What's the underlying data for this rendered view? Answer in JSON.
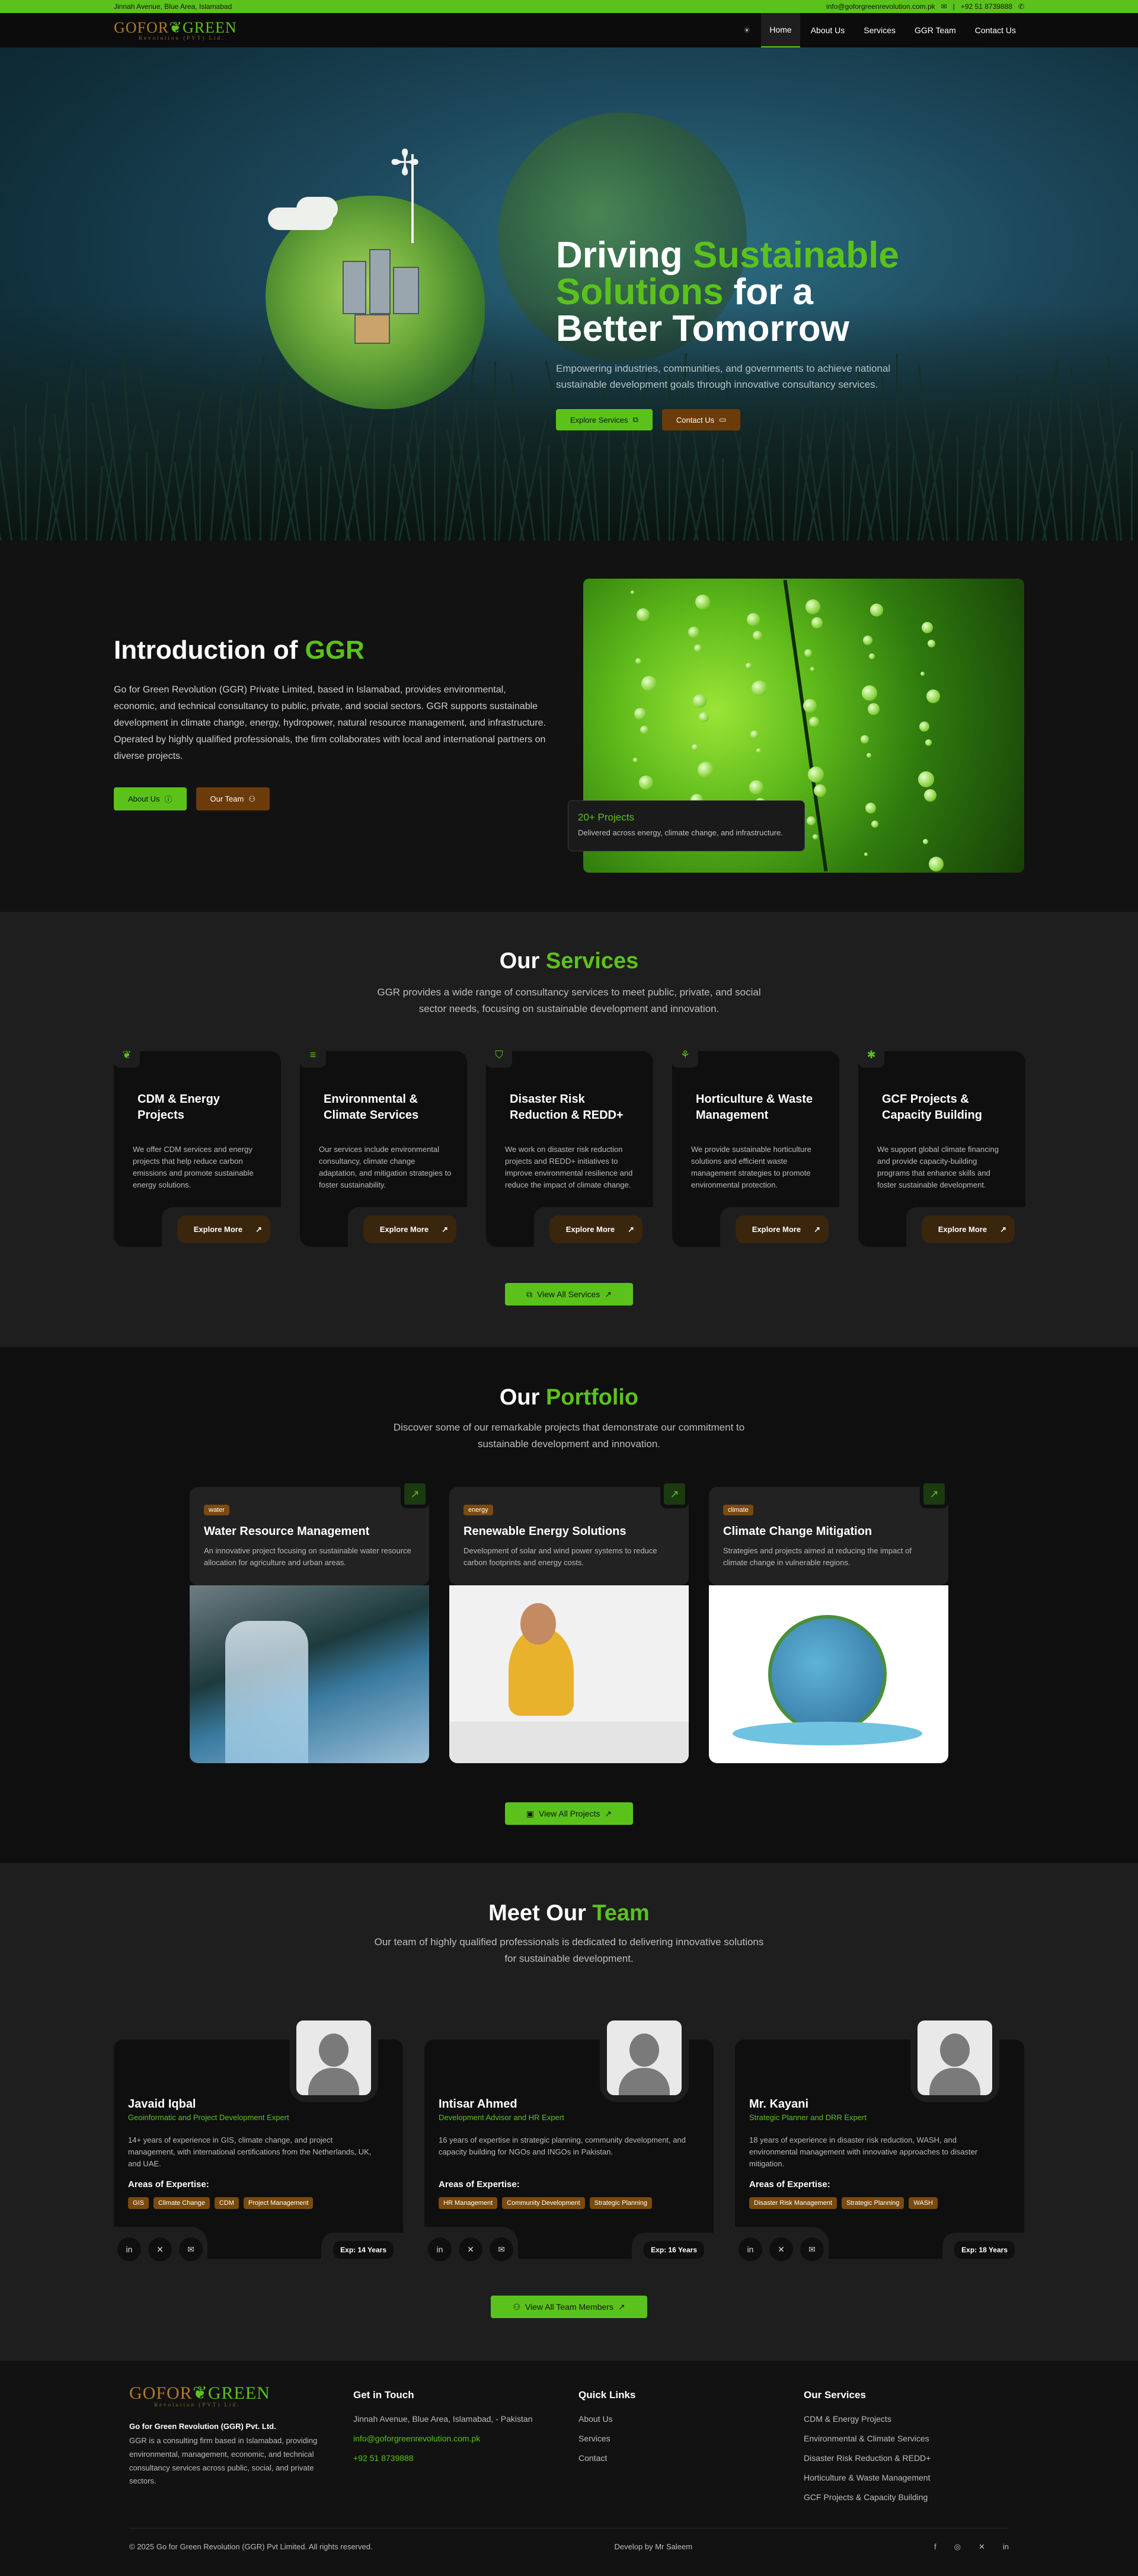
{
  "topbar": {
    "address": "Jinnah Avenue, Blue Area, Islamabad",
    "email": "info@goforgreenrevolution.com.pk",
    "phone": "+92 51 8739888"
  },
  "brand": {
    "logo_left": "GOFOR",
    "logo_right": "GREEN",
    "logo_sub": "Revolution (PVT) Ltd."
  },
  "nav": {
    "items": [
      "Home",
      "About Us",
      "Services",
      "GGR Team",
      "Contact Us"
    ],
    "active": "Home"
  },
  "hero": {
    "title_1": "Driving ",
    "title_2": "Sustainable",
    "title_3": "Solutions",
    "title_4": " for a",
    "title_5": "Better Tomorrow",
    "subtitle": "Empowering industries, communities, and governments to achieve national sustainable development goals through innovative consultancy services.",
    "primary_button": "Explore Services",
    "secondary_button": "Contact Us"
  },
  "intro": {
    "title_1": "Introduction of ",
    "title_2": "GGR",
    "body": "Go for Green Revolution (GGR) Private Limited, based in Islamabad, provides environmental, economic, and technical consultancy to public, private, and social sectors. GGR supports sustainable development in climate change, energy, hydropower, natural resource management, and infrastructure. Operated by highly qualified professionals, the firm collaborates with local and international partners on diverse projects.",
    "about_button": "About Us",
    "team_button": "Our Team",
    "projects_count": "20+ Projects",
    "projects_desc": "Delivered across energy, climate change, and infrastructure."
  },
  "services": {
    "title_1": "Our ",
    "title_2": "Services",
    "subtitle": "GGR provides a wide range of consultancy services to meet public, private, and social sector needs, focusing on sustainable development and innovation.",
    "items": [
      {
        "icon": "leaf-icon",
        "title": "CDM & Energy Projects",
        "desc": "We offer CDM services and energy projects that help reduce carbon emissions and promote sustainable energy solutions.",
        "more": "Explore More"
      },
      {
        "icon": "menu-icon",
        "title": "Environmental & Climate Services",
        "desc": "Our services include environmental consultancy, climate change adaptation, and mitigation strategies to foster sustainability.",
        "more": "Explore More"
      },
      {
        "icon": "shield-icon",
        "title": "Disaster Risk Reduction & REDD+",
        "desc": "We work on disaster risk reduction projects and REDD+ initiatives to improve environmental resilience and reduce the impact of climate change.",
        "more": "Explore More"
      },
      {
        "icon": "sprout-icon",
        "title": "Horticulture & Waste Management",
        "desc": "We provide sustainable horticulture solutions and efficient waste management strategies to promote environmental protection.",
        "more": "Explore More"
      },
      {
        "icon": "tools-icon",
        "title": "GCF Projects & Capacity Building",
        "desc": "We support global climate financing and provide capacity-building programs that enhance skills and foster sustainable development.",
        "more": "Explore More"
      }
    ],
    "view_all": "View All Services"
  },
  "portfolio": {
    "title_1": "Our ",
    "title_2": "Portfolio",
    "subtitle": "Discover some of our remarkable projects that demonstrate our commitment to sustainable development and innovation.",
    "items": [
      {
        "tag": "water",
        "title": "Water Resource Management",
        "desc": "An innovative project focusing on sustainable water resource allocation for agriculture and urban areas."
      },
      {
        "tag": "energy",
        "title": "Renewable Energy Solutions",
        "desc": "Development of solar and wind power systems to reduce carbon footprints and energy costs."
      },
      {
        "tag": "climate",
        "title": "Climate Change Mitigation",
        "desc": "Strategies and projects aimed at reducing the impact of climate change in vulnerable regions."
      }
    ],
    "view_all": "View All Projects"
  },
  "team": {
    "title_1": "Meet Our ",
    "title_2": "Team",
    "subtitle": "Our team of highly qualified professionals is dedicated to delivering innovative solutions for sustainable development.",
    "expertise_label": "Areas of Expertise:",
    "members": [
      {
        "name": "Javaid Iqbal",
        "role": "Geoinformatic and Project Development Expert",
        "bio": "14+ years of experience in GIS, climate change, and project management, with international certifications from the Netherlands, UK, and UAE.",
        "tags": [
          "GIS",
          "Climate Change",
          "CDM",
          "Project Management"
        ],
        "exp": "Exp: 14 Years"
      },
      {
        "name": "Intisar Ahmed",
        "role": "Development Advisor and HR Expert",
        "bio": "16 years of expertise in strategic planning, community development, and capacity building for NGOs and INGOs in Pakistan.",
        "tags": [
          "HR Management",
          "Community Development",
          "Strategic Planning"
        ],
        "exp": "Exp: 16 Years"
      },
      {
        "name": "Mr. Kayani",
        "role": "Strategic Planner and DRR Expert",
        "bio": "18 years of experience in disaster risk reduction, WASH, and environmental management with innovative approaches to disaster mitigation.",
        "tags": [
          "Disaster Risk Management",
          "Strategic Planning",
          "WASH"
        ],
        "exp": "Exp: 18 Years"
      }
    ],
    "view_all": "View All Team Members"
  },
  "footer": {
    "company": "Go for Green Revolution (GGR) Pvt. Ltd.",
    "about": "GGR is a consulting firm based in Islamabad, providing environmental, management, economic, and technical consultancy services across public, social, and private sectors.",
    "contact_title": "Get in Touch",
    "address": "Jinnah Avenue, Blue Area, Islamabad, - Pakistan",
    "email": "info@goforgreenrevolution.com.pk",
    "phone": "+92 51 8739888",
    "links_title": "Quick Links",
    "links": [
      "About Us",
      "Services",
      "Contact"
    ],
    "services_title": "Our Services",
    "services": [
      "CDM & Energy Projects",
      "Environmental & Climate Services",
      "Disaster Risk Reduction & REDD+",
      "Horticulture & Waste Management",
      "GCF Projects & Capacity Building"
    ],
    "copyright": "© 2025 Go for Green Revolution (GGR) Pvt Limited. All rights reserved.",
    "credit": "Develop by Mr Saleem"
  },
  "colors": {
    "accent": "#5bc21c",
    "brown": "#6b3c0a",
    "dark": "#0f0f0f",
    "panel": "#1e1e1e"
  }
}
